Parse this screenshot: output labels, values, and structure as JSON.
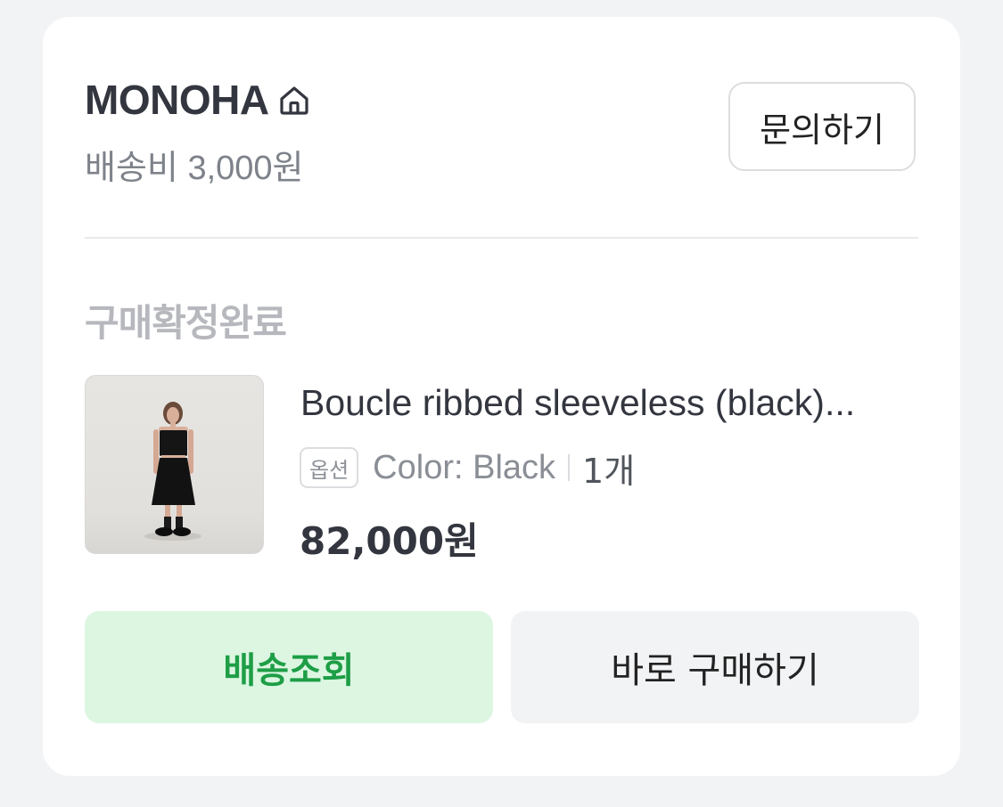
{
  "store": {
    "name": "MONOHA",
    "icon": "home-icon",
    "shipping_fee": "배송비 3,000원",
    "inquiry_label": "문의하기"
  },
  "order": {
    "status": "구매확정완료",
    "product": {
      "image": "product-photo",
      "name": "Boucle ribbed sleeveless (black)...",
      "option_badge": "옵션",
      "option_value": "Color: Black",
      "quantity": "1개",
      "price": "82,000원"
    }
  },
  "actions": {
    "track_label": "배송조회",
    "buy_again_label": "바로 구매하기"
  },
  "colors": {
    "track_bg": "#dcf6e2",
    "track_text": "#1e9e46",
    "secondary_bg": "#f2f3f5"
  }
}
